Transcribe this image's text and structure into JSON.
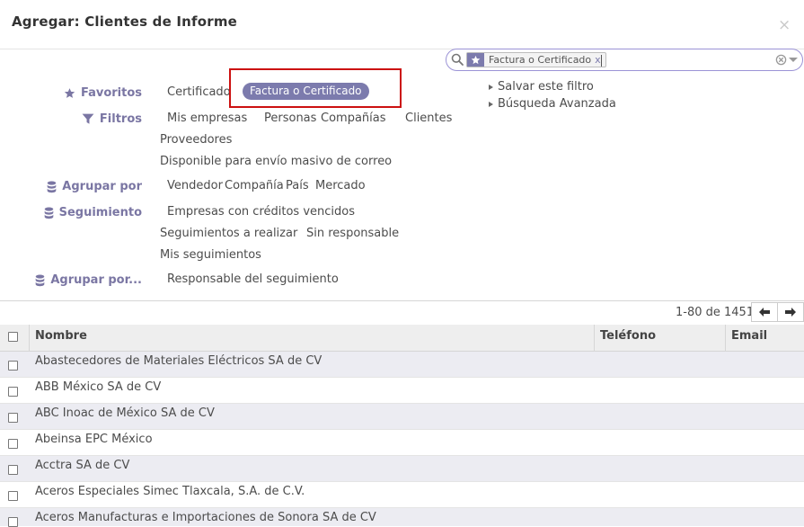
{
  "modal": {
    "title": "Agregar: Clientes de Informe",
    "close_label": "×"
  },
  "search": {
    "facet_label": "Factura o Certificado",
    "facet_remove": "x",
    "query": ""
  },
  "filters": {
    "favoritos": {
      "label": "Favoritos",
      "items": [
        "Certificado",
        "Factura o Certificado"
      ]
    },
    "filtros": {
      "label": "Filtros",
      "items": [
        "Mis empresas",
        "Personas",
        "Compañías",
        "Clientes",
        "Proveedores",
        "Disponible para envío masivo de correo"
      ]
    },
    "agrupar": {
      "label": "Agrupar por",
      "items": [
        "Vendedor",
        "Compañía",
        "País",
        "Mercado"
      ]
    },
    "seguimiento": {
      "label": "Seguimiento",
      "items": [
        "Empresas con créditos vencidos",
        "Seguimientos a realizar",
        "Sin responsable",
        "Mis seguimientos"
      ]
    },
    "agrupar2": {
      "label": "Agrupar por...",
      "items": [
        "Responsable del seguimiento"
      ]
    },
    "side_links": [
      "Salvar este filtro",
      "Búsqueda Avanzada"
    ]
  },
  "pager": {
    "text": "1-80 de 1451"
  },
  "table": {
    "columns": [
      "Nombre",
      "Teléfono",
      "Email"
    ],
    "rows": [
      "Abastecedores de Materiales Eléctricos SA de CV",
      "ABB México SA de CV",
      "ABC Inoac de México SA de CV",
      "Abeinsa EPC México",
      "Acctra SA de CV",
      "Aceros Especiales Simec Tlaxcala, S.A. de C.V.",
      "Aceros Manufacturas e Importaciones de Sonora SA de CV"
    ]
  },
  "colors": {
    "accent": "#7c7bad",
    "highlight": "#cc1111"
  }
}
